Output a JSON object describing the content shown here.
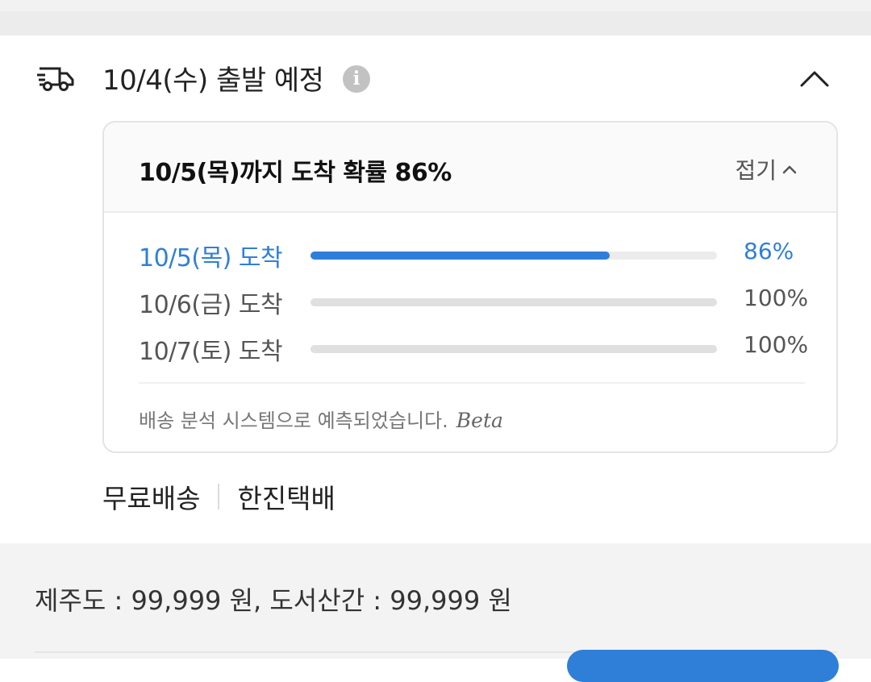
{
  "delivery": {
    "departure_text": "10/4(수) 출발 예정",
    "info_icon": "info-icon",
    "truck_icon": "truck-icon",
    "collapse_icon": "chevron-up-icon"
  },
  "probability_card": {
    "title": "10/5(목)까지 도착 확률 86%",
    "fold_label": "접기",
    "rows": [
      {
        "label": "10/5(목) 도착",
        "percent_text": "86%",
        "value": 0.86,
        "active": true
      },
      {
        "label": "10/6(금) 도착",
        "percent_text": "100%",
        "value": 1.0,
        "active": false
      },
      {
        "label": "10/7(토) 도착",
        "percent_text": "100%",
        "value": 1.0,
        "active": false
      }
    ],
    "analysis_note": "배송 분석 시스템으로 예측되었습니다.",
    "beta_label": "Beta"
  },
  "shipping": {
    "fee_type": "무료배송",
    "carrier": "한진택배"
  },
  "extra_fee": {
    "text": "제주도 : 99,999 원, 도서산간 : 99,999 원"
  },
  "colors": {
    "accent": "#2f7fd9",
    "track": "#ececec",
    "track_inactive_fill": "#e0e0e0"
  }
}
